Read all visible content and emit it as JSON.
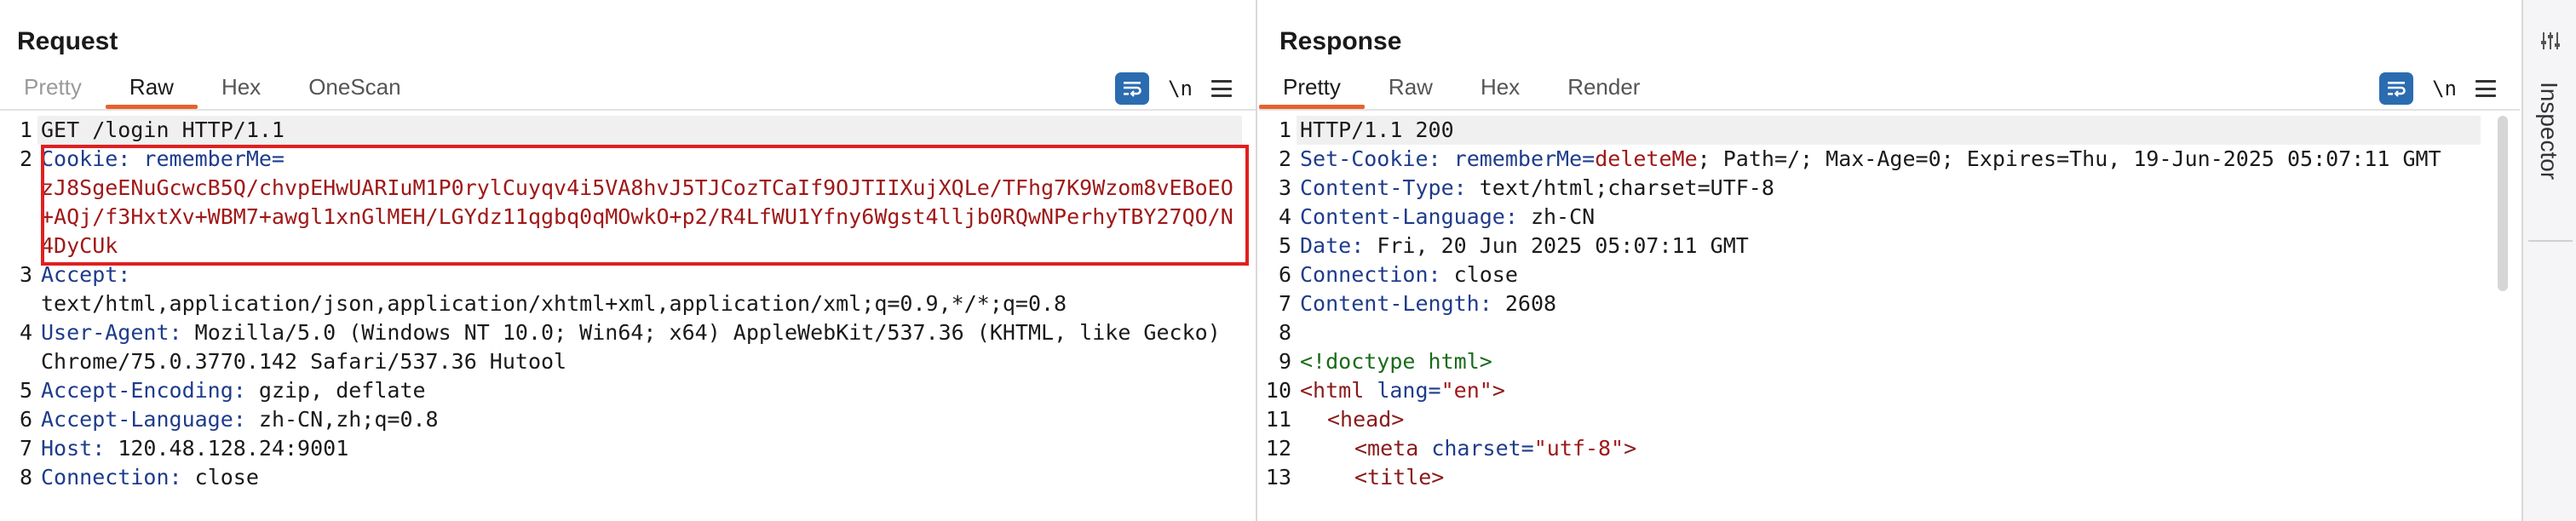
{
  "request": {
    "title": "Request",
    "tabs": [
      {
        "label": "Pretty",
        "state": "dim"
      },
      {
        "label": "Raw",
        "state": "active"
      },
      {
        "label": "Hex",
        "state": "normal"
      },
      {
        "label": "OneScan",
        "state": "normal"
      }
    ],
    "newline_label": "\\n",
    "lines": [
      {
        "n": "1",
        "key": "",
        "value": "",
        "text": "GET /login HTTP/1.1"
      },
      {
        "n": "2",
        "key": "Cookie:",
        "value": "rememberMe=",
        "text": "zJ8SgeENuGcwcB5Q/chvpEHwUARIuM1P0rylCuyqv4i5VA8hvJ5TJCozTCaIf9OJTIIXujXQLe/TFhg7K9Wzom8vEBoEO+AQj/f3HxtXv+WBM7+awgl1xnGlMEH/LGYdz11qgbq0qMOwkO+p2/R4LfWU1Yfny6Wgst4lljb0RQwNPerhyTBY27QO/N4DyCUk"
      },
      {
        "n": "3",
        "key": "Accept:",
        "value": "",
        "text": "text/html,application/json,application/xhtml+xml,application/xml;q=0.9,*/*;q=0.8"
      },
      {
        "n": "4",
        "key": "User-Agent:",
        "value": "Mozilla/5.0 (Windows NT 10.0; Win64; x64) AppleWebKit/537.36 (KHTML, like Gecko) Chrome/75.0.3770.142 Safari/537.36 Hutool",
        "text": ""
      },
      {
        "n": "5",
        "key": "Accept-Encoding:",
        "value": "gzip, deflate",
        "text": ""
      },
      {
        "n": "6",
        "key": "Accept-Language:",
        "value": "zh-CN,zh;q=0.8",
        "text": ""
      },
      {
        "n": "7",
        "key": "Host:",
        "value": "120.48.128.24:9001",
        "text": ""
      },
      {
        "n": "8",
        "key": "Connection:",
        "value": "close",
        "text": ""
      }
    ]
  },
  "response": {
    "title": "Response",
    "tabs": [
      {
        "label": "Pretty",
        "state": "active"
      },
      {
        "label": "Raw",
        "state": "normal"
      },
      {
        "label": "Hex",
        "state": "normal"
      },
      {
        "label": "Render",
        "state": "normal"
      }
    ],
    "newline_label": "\\n",
    "status_line": "HTTP/1.1 200",
    "set_cookie_key": "Set-Cookie:",
    "set_cookie_name": "rememberMe=",
    "set_cookie_value": "deleteMe",
    "set_cookie_rest": "; Path=/; Max-Age=0; Expires=Thu, 19-Jun-2025 05:07:11 GMT",
    "headers": [
      {
        "n": "3",
        "key": "Content-Type:",
        "value": "text/html;charset=UTF-8"
      },
      {
        "n": "4",
        "key": "Content-Language:",
        "value": "zh-CN"
      },
      {
        "n": "5",
        "key": "Date:",
        "value": "Fri, 20 Jun 2025 05:07:11 GMT"
      },
      {
        "n": "6",
        "key": "Connection:",
        "value": "close"
      },
      {
        "n": "7",
        "key": "Content-Length:",
        "value": "2608"
      }
    ],
    "doctype": "<!doctype html>",
    "html_open": "<html",
    "html_attr": "lang=",
    "html_attr_val": "\"en\"",
    "html_close": ">",
    "head_tag": "<head>",
    "meta_open": "<meta",
    "meta_attr": "charset=",
    "meta_val": "\"utf-8\"",
    "meta_close": ">",
    "title_tag": "<title>"
  },
  "inspector": {
    "label": "Inspector"
  },
  "colors": {
    "accent_orange": "#e8622c",
    "button_blue": "#2b6cb0",
    "highlight_red": "#e02020"
  }
}
